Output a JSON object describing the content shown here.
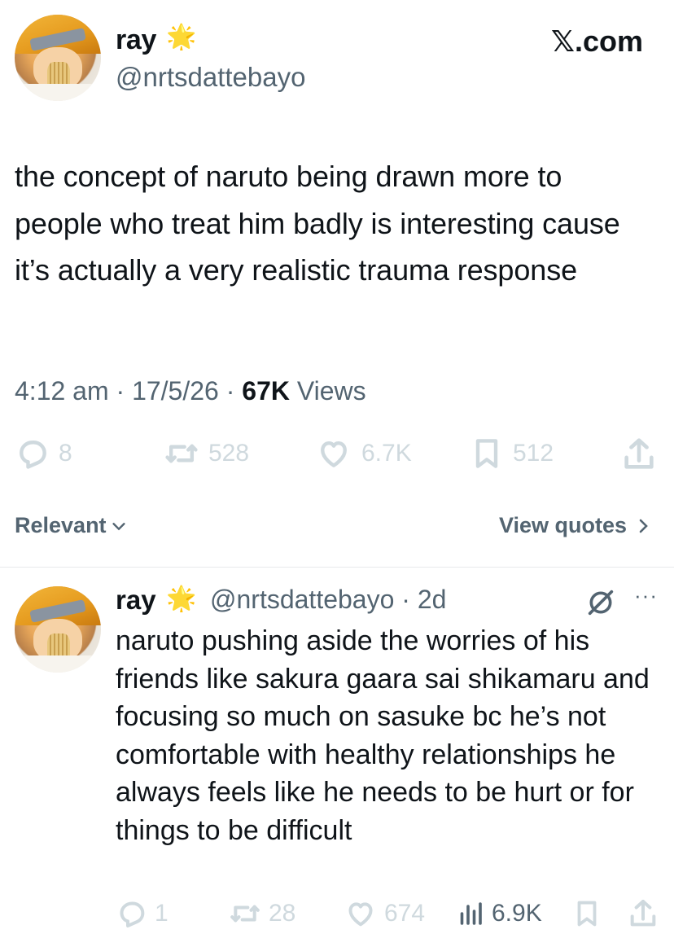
{
  "header": {
    "x_logo": "𝕏.com"
  },
  "tweet": {
    "display_name": "ray",
    "verified_badge": "🌟",
    "handle": "@nrtsdattebayo",
    "text": "the concept of naruto being drawn more to people who treat him badly is interesting cause it’s actually a very realistic trauma response",
    "time": "4:12 am",
    "date": "17/5/26",
    "views_count": "67K",
    "views_label": "Views",
    "actions": {
      "replies": "8",
      "reposts": "528",
      "likes": "6.7K",
      "bookmarks": "512"
    }
  },
  "sort": {
    "relevant_label": "Relevant",
    "view_quotes_label": "View quotes"
  },
  "reply": {
    "display_name": "ray",
    "verified_badge": "🌟",
    "handle_time": "@nrtsdattebayo · 2d",
    "text": "naruto pushing aside the worries of his friends like sakura gaara sai shikamaru and focusing so much on sasuke bc he’s not comfortable with healthy relationships he always feels like he needs to be hurt or for things to be difficult",
    "more": "···",
    "actions": {
      "replies": "1",
      "reposts": "28",
      "likes": "674",
      "views": "6.9K"
    }
  },
  "colors": {
    "text": "#0f1419",
    "secondary": "#536471",
    "faint": "#cfd9de",
    "star": "#f3b51e"
  }
}
